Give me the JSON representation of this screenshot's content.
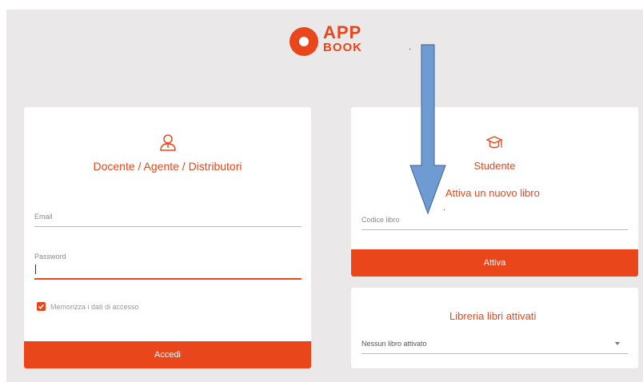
{
  "logo": {
    "line1": "APP",
    "line2": "BOOK"
  },
  "teacher": {
    "title": "Docente / Agente / Distributori",
    "email_label": "Email",
    "password_label": "Password",
    "remember_label": "Memorizza i dati di accesso",
    "remember_checked": true,
    "login_button": "Accedi"
  },
  "student": {
    "title": "Studente",
    "activate_heading": "Attiva un nuovo libro",
    "code_label": "Codice libro",
    "activate_button": "Attiva"
  },
  "library": {
    "title": "Libreria libri attivati",
    "select_value": "Nessun libro attivato"
  },
  "colors": {
    "accent": "#e9461b",
    "background": "#eae8e9",
    "arrow": "#6f9bd3"
  }
}
